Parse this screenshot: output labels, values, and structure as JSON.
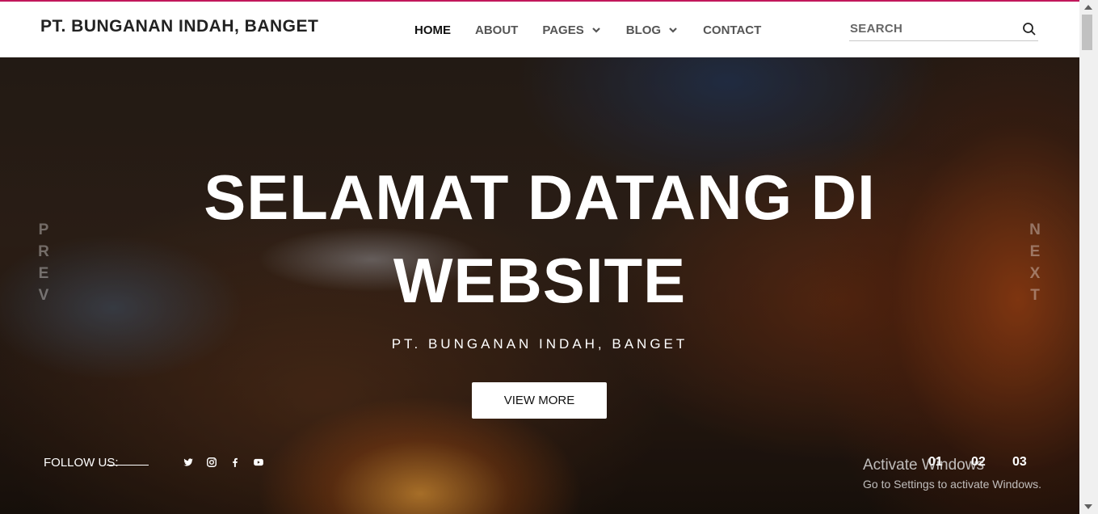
{
  "brand": "PT. BUNGANAN INDAH, BANGET",
  "nav": {
    "home": "HOME",
    "about": "ABOUT",
    "pages": "PAGES",
    "blog": "BLOG",
    "contact": "CONTACT"
  },
  "search": {
    "placeholder": "SEARCH",
    "icon": "search-icon"
  },
  "hero": {
    "title_line1": "SELAMAT DATANG DI",
    "title_line2": "WEBSITE",
    "subtitle": "PT. BUNGANAN INDAH, BANGET",
    "button": "VIEW MORE",
    "prev": [
      "P",
      "R",
      "E",
      "V"
    ],
    "next": [
      "N",
      "E",
      "X",
      "T"
    ]
  },
  "follow": {
    "label": "FOLLOW US:",
    "icons": [
      "twitter-icon",
      "instagram-icon",
      "facebook-icon",
      "youtube-icon"
    ]
  },
  "slides": [
    "01",
    "02",
    "03"
  ],
  "watermark": {
    "line1": "Activate Windows",
    "line2": "Go to Settings to activate Windows."
  },
  "colors": {
    "accent": "#c2185b",
    "header_bg": "#ffffff",
    "text_dark": "#222222"
  }
}
